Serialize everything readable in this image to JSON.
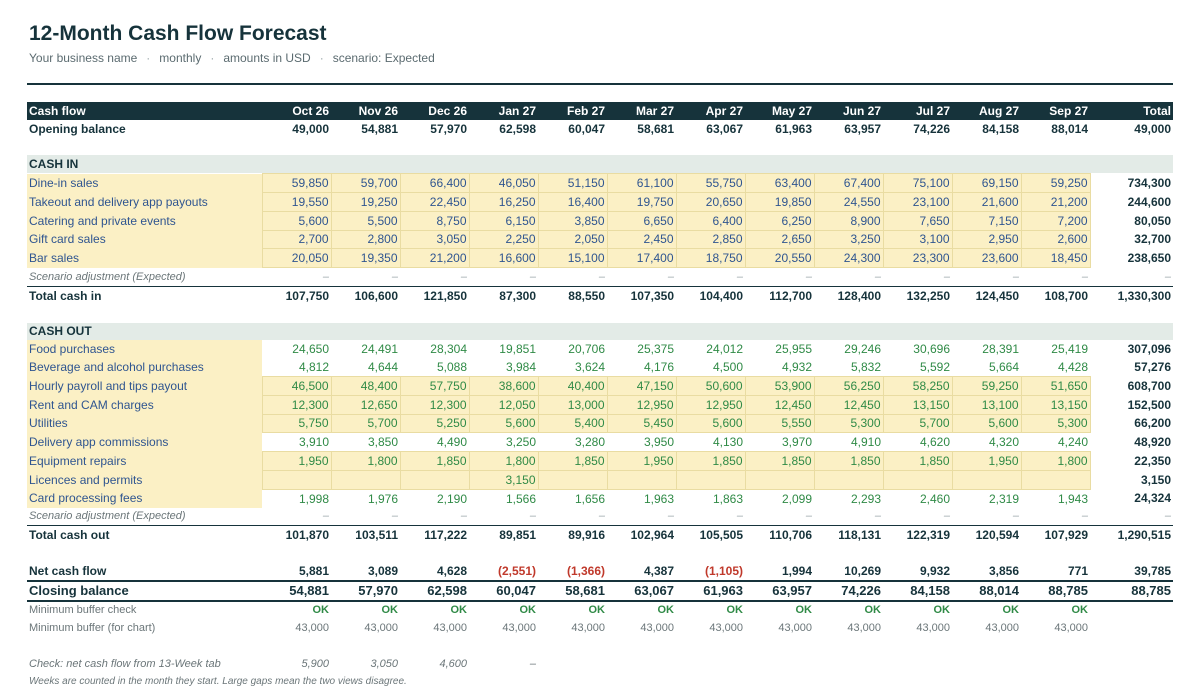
{
  "header": {
    "title": "12-Month Cash Flow Forecast",
    "business": "Your business name",
    "frequency": "monthly",
    "currency": "amounts in USD",
    "scenario": "scenario: Expected",
    "separator": "·"
  },
  "colors": {
    "dark": "#16333b",
    "input_bg": "#fbf0c5",
    "section_bg": "#e3ebe7",
    "positive": "#2f8a46",
    "negative": "#c0392b",
    "input_text": "#2f5590"
  },
  "columns": {
    "label": "Cash flow",
    "months": [
      "Oct 26",
      "Nov 26",
      "Dec 26",
      "Jan 27",
      "Feb 27",
      "Mar 27",
      "Apr 27",
      "May 27",
      "Jun 27",
      "Jul 27",
      "Aug 27",
      "Sep 27"
    ],
    "total": "Total"
  },
  "opening": {
    "label": "Opening balance",
    "values": [
      "49,000",
      "54,881",
      "57,970",
      "62,598",
      "60,047",
      "58,681",
      "63,067",
      "61,963",
      "63,957",
      "74,226",
      "84,158",
      "88,014"
    ],
    "total": "49,000"
  },
  "cash_in": {
    "section": "CASH IN",
    "rows": [
      {
        "label": "Dine-in sales",
        "values": [
          "59,850",
          "59,700",
          "66,400",
          "46,050",
          "51,150",
          "61,100",
          "55,750",
          "63,400",
          "67,400",
          "75,100",
          "69,150",
          "59,250"
        ],
        "total": "734,300"
      },
      {
        "label": "Takeout and delivery app payouts",
        "values": [
          "19,550",
          "19,250",
          "22,450",
          "16,250",
          "16,400",
          "19,750",
          "20,650",
          "19,850",
          "24,550",
          "23,100",
          "21,600",
          "21,200"
        ],
        "total": "244,600"
      },
      {
        "label": "Catering and private events",
        "values": [
          "5,600",
          "5,500",
          "8,750",
          "6,150",
          "3,850",
          "6,650",
          "6,400",
          "6,250",
          "8,900",
          "7,650",
          "7,150",
          "7,200"
        ],
        "total": "80,050"
      },
      {
        "label": "Gift card sales",
        "values": [
          "2,700",
          "2,800",
          "3,050",
          "2,250",
          "2,050",
          "2,450",
          "2,850",
          "2,650",
          "3,250",
          "3,100",
          "2,950",
          "2,600"
        ],
        "total": "32,700"
      },
      {
        "label": "Bar sales",
        "values": [
          "20,050",
          "19,350",
          "21,200",
          "16,600",
          "15,100",
          "17,400",
          "18,750",
          "20,550",
          "24,300",
          "23,300",
          "23,600",
          "18,450"
        ],
        "total": "238,650"
      }
    ],
    "adjustment": {
      "label": "Scenario adjustment (Expected)",
      "values": [
        "–",
        "–",
        "–",
        "–",
        "–",
        "–",
        "–",
        "–",
        "–",
        "–",
        "–",
        "–"
      ],
      "total": "–"
    },
    "total": {
      "label": "Total cash in",
      "values": [
        "107,750",
        "106,600",
        "121,850",
        "87,300",
        "88,550",
        "107,350",
        "104,400",
        "112,700",
        "128,400",
        "132,250",
        "124,450",
        "108,700"
      ],
      "total": "1,330,300"
    }
  },
  "cash_out": {
    "section": "CASH OUT",
    "rows": [
      {
        "label": "Food purchases",
        "values": [
          "24,650",
          "24,491",
          "28,304",
          "19,851",
          "20,706",
          "25,375",
          "24,012",
          "25,955",
          "29,246",
          "30,696",
          "28,391",
          "25,419"
        ],
        "total": "307,096"
      },
      {
        "label": "Beverage and alcohol purchases",
        "values": [
          "4,812",
          "4,644",
          "5,088",
          "3,984",
          "3,624",
          "4,176",
          "4,500",
          "4,932",
          "5,832",
          "5,592",
          "5,664",
          "4,428"
        ],
        "total": "57,276"
      },
      {
        "label": "Hourly payroll and tips payout",
        "values": [
          "46,500",
          "48,400",
          "57,750",
          "38,600",
          "40,400",
          "47,150",
          "50,600",
          "53,900",
          "56,250",
          "58,250",
          "59,250",
          "51,650"
        ],
        "total": "608,700"
      },
      {
        "label": "Rent and CAM charges",
        "values": [
          "12,300",
          "12,650",
          "12,300",
          "12,050",
          "13,000",
          "12,950",
          "12,950",
          "12,450",
          "12,450",
          "13,150",
          "13,100",
          "13,150"
        ],
        "total": "152,500"
      },
      {
        "label": "Utilities",
        "values": [
          "5,750",
          "5,700",
          "5,250",
          "5,600",
          "5,400",
          "5,450",
          "5,600",
          "5,550",
          "5,300",
          "5,700",
          "5,600",
          "5,300"
        ],
        "total": "66,200"
      },
      {
        "label": "Delivery app commissions",
        "values": [
          "3,910",
          "3,850",
          "4,490",
          "3,250",
          "3,280",
          "3,950",
          "4,130",
          "3,970",
          "4,910",
          "4,620",
          "4,320",
          "4,240"
        ],
        "total": "48,920"
      },
      {
        "label": "Equipment repairs",
        "values": [
          "1,950",
          "1,800",
          "1,850",
          "1,800",
          "1,850",
          "1,950",
          "1,850",
          "1,850",
          "1,850",
          "1,850",
          "1,950",
          "1,800"
        ],
        "total": "22,350"
      },
      {
        "label": "Licences and permits",
        "values": [
          "",
          "",
          "",
          "3,150",
          "",
          "",
          "",
          "",
          "",
          "",
          "",
          ""
        ],
        "total": "3,150"
      },
      {
        "label": "Card processing fees",
        "values": [
          "1,998",
          "1,976",
          "2,190",
          "1,566",
          "1,656",
          "1,963",
          "1,863",
          "2,099",
          "2,293",
          "2,460",
          "2,319",
          "1,943"
        ],
        "total": "24,324"
      }
    ],
    "adjustment": {
      "label": "Scenario adjustment (Expected)",
      "values": [
        "–",
        "–",
        "–",
        "–",
        "–",
        "–",
        "–",
        "–",
        "–",
        "–",
        "–",
        "–"
      ],
      "total": "–"
    },
    "total": {
      "label": "Total cash out",
      "values": [
        "101,870",
        "103,511",
        "117,222",
        "89,851",
        "89,916",
        "102,964",
        "105,505",
        "110,706",
        "118,131",
        "122,319",
        "120,594",
        "107,929"
      ],
      "total": "1,290,515"
    }
  },
  "net": {
    "label": "Net cash flow",
    "values": [
      "5,881",
      "3,089",
      "4,628",
      "(2,551)",
      "(1,366)",
      "4,387",
      "(1,105)",
      "1,994",
      "10,269",
      "9,932",
      "3,856",
      "771"
    ],
    "total": "39,785"
  },
  "closing": {
    "label": "Closing balance",
    "values": [
      "54,881",
      "57,970",
      "62,598",
      "60,047",
      "58,681",
      "63,067",
      "61,963",
      "63,957",
      "74,226",
      "84,158",
      "88,014",
      "88,785"
    ],
    "total": "88,785"
  },
  "buffer_check": {
    "label": "Minimum buffer check",
    "values": [
      "OK",
      "OK",
      "OK",
      "OK",
      "OK",
      "OK",
      "OK",
      "OK",
      "OK",
      "OK",
      "OK",
      "OK"
    ]
  },
  "buffer_chart": {
    "label": "Minimum buffer (for chart)",
    "values": [
      "43,000",
      "43,000",
      "43,000",
      "43,000",
      "43,000",
      "43,000",
      "43,000",
      "43,000",
      "43,000",
      "43,000",
      "43,000",
      "43,000"
    ]
  },
  "check13": {
    "label": "Check: net cash flow from 13-Week tab",
    "values": [
      "5,900",
      "3,050",
      "4,600",
      "–"
    ]
  },
  "note": "Weeks are counted in the month they start. Large gaps mean the two views disagree."
}
